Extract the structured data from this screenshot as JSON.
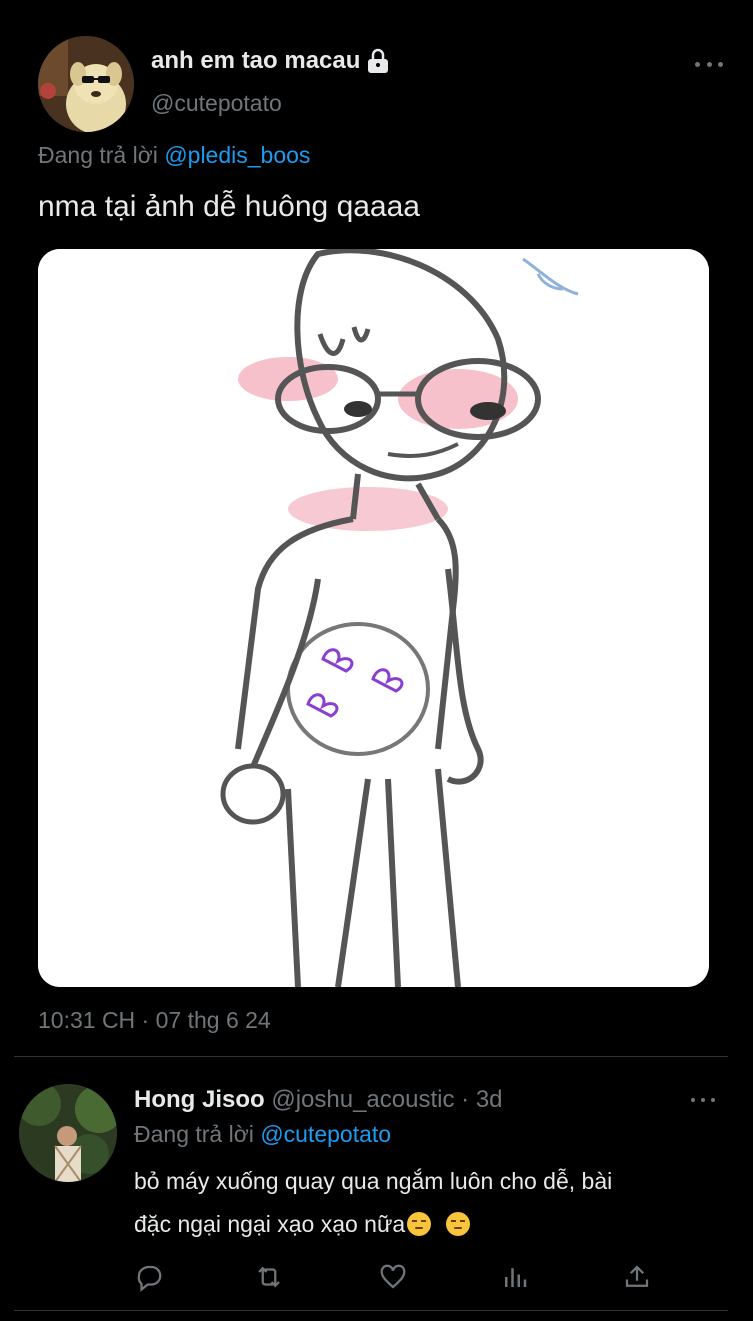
{
  "main_tweet": {
    "display_name": "anh em tao macau",
    "handle": "@cutepotato",
    "replying_prefix": "Đang trả lời",
    "replying_to": "@pledis_boos",
    "text": "nma tại ảnh dễ huông qaaaa",
    "timestamp": "10:31 CH · 07 thg 6 24",
    "icons": {
      "lock": "lock-icon",
      "more": "more-icon"
    }
  },
  "reply": {
    "display_name": "Hong Jisoo",
    "handle": "@joshu_acoustic",
    "separator": "·",
    "time": "3d",
    "replying_prefix": "Đang trả lời",
    "replying_to": "@cutepotato",
    "text_line1": "bỏ máy xuống quay qua ngắm luôn cho dễ, bài",
    "text_line2": "đặc ngại ngại xạo xạo nữa",
    "emoji": "😒",
    "actions": [
      "reply-icon",
      "retweet-icon",
      "like-icon",
      "views-icon",
      "share-icon"
    ]
  },
  "colors": {
    "background": "#000000",
    "text": "#e7e9ea",
    "secondary": "#71767b",
    "accent": "#1d9bf0",
    "divider": "#2f3336"
  }
}
